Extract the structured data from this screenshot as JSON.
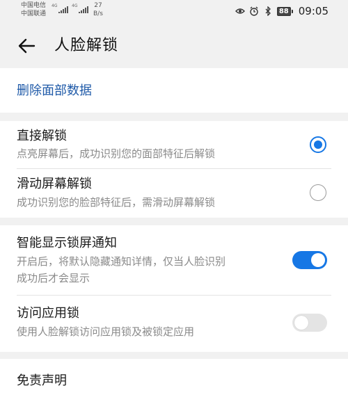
{
  "status_bar": {
    "carrier_1": "中国电信",
    "carrier_2": "中国联通",
    "network_1": "4G",
    "network_2": "4G",
    "speed_value": "27",
    "speed_unit": "B/s",
    "icons": [
      "eye-icon",
      "alarm-icon",
      "bluetooth-icon"
    ],
    "battery": "88",
    "time": "09:05"
  },
  "header": {
    "back_icon": "arrow-left-icon",
    "title": "人脸解锁"
  },
  "delete_face_data": "删除面部数据",
  "unlock_modes": [
    {
      "title": "直接解锁",
      "subtitle": "点亮屏幕后，成功识别您的面部特征后解锁",
      "selected": true
    },
    {
      "title": "滑动屏幕解锁",
      "subtitle": "成功识别您的脸部特征后，需滑动屏幕解锁",
      "selected": false
    }
  ],
  "toggles": [
    {
      "title": "智能显示锁屏通知",
      "subtitle_line1": "开启后，将默认隐藏通知详情，仅当人脸识别",
      "subtitle_line2": "成功后才会显示",
      "enabled": true
    },
    {
      "title": "访问应用锁",
      "subtitle": "使用人脸解锁访问应用锁及被锁定应用",
      "enabled": false
    }
  ],
  "disclaimer": "免责声明",
  "colors": {
    "accent": "#1677e5",
    "link": "#1f5aa8",
    "background": "#f1f1f1",
    "card": "#ffffff",
    "secondary_text": "#8a8a8a"
  }
}
